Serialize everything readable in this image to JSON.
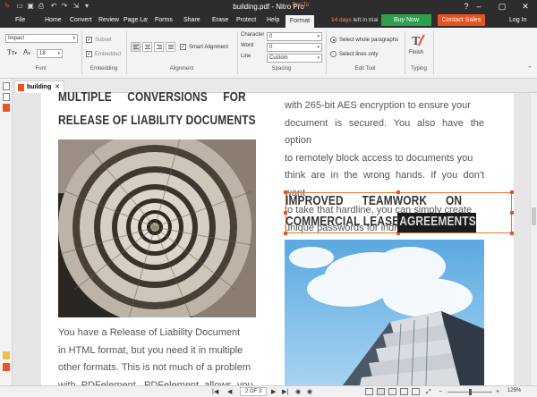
{
  "window": {
    "title": "building.pdf - Nitro Pro"
  },
  "menubar": {
    "items": [
      "File",
      "Home",
      "Convert",
      "Review",
      "Page Layout",
      "Forms",
      "Share",
      "Erase",
      "Protect",
      "Help",
      "Format"
    ],
    "context_tab": "Text To",
    "trial_days": "14 days",
    "trial_text": "left in trial",
    "buy_now": "Buy Now",
    "contact_sales": "Contact Sales",
    "login": "Log In"
  },
  "ribbon": {
    "font": {
      "family": "Impact",
      "size": "18",
      "label": "Font"
    },
    "embedding": {
      "subset": "Subset",
      "embedded": "Embedded",
      "label": "Embedding"
    },
    "alignment": {
      "smart_alignment": "Smart Alignment",
      "label": "Alignment"
    },
    "spacing": {
      "character_label": "Character",
      "word_label": "Word",
      "line_label": "Line",
      "character_value": "0",
      "word_value": "0",
      "line_value": "Custom",
      "label": "Spacing"
    },
    "edit_tool": {
      "select_paragraphs": "Select whole paragraphs",
      "select_lines": "Select lines only",
      "label": "Edit Tool"
    },
    "typing": {
      "finish": "Finish",
      "label": "Typing"
    }
  },
  "tab": {
    "name": "building"
  },
  "document": {
    "left_heading_1": "MULTIPLE     CONVERSIONS     FOR",
    "left_heading_2": "RELEASE OF LIABILITY DOCUMENTS",
    "left_body": [
      "You have a Release of Liability Document",
      "in HTML format, but you need it in multiple",
      "other formats. This is not much of a problem",
      "with  PDFelement.  PDFelement  allows  you"
    ],
    "right_body": [
      "with 265-bit AES encryption to ensure your",
      "document is secured. You also have the option",
      "to remotely block access to documents you",
      "think are in the wrong hands. If you don't want",
      "to take that hardline, you can simply create",
      "unique passwords for individual users."
    ],
    "right_heading_1": "IMPROVED      TEAMWORK      ON",
    "right_heading_2a": "COMMERCIAL LEASE",
    "right_heading_2b": "AGREEMENTS"
  },
  "statusbar": {
    "page": "2 OF 3",
    "zoom": "125%"
  },
  "colors": {
    "accent": "#e8531f",
    "buy": "#2e9e4f",
    "titlebar": "#2d2d30"
  }
}
